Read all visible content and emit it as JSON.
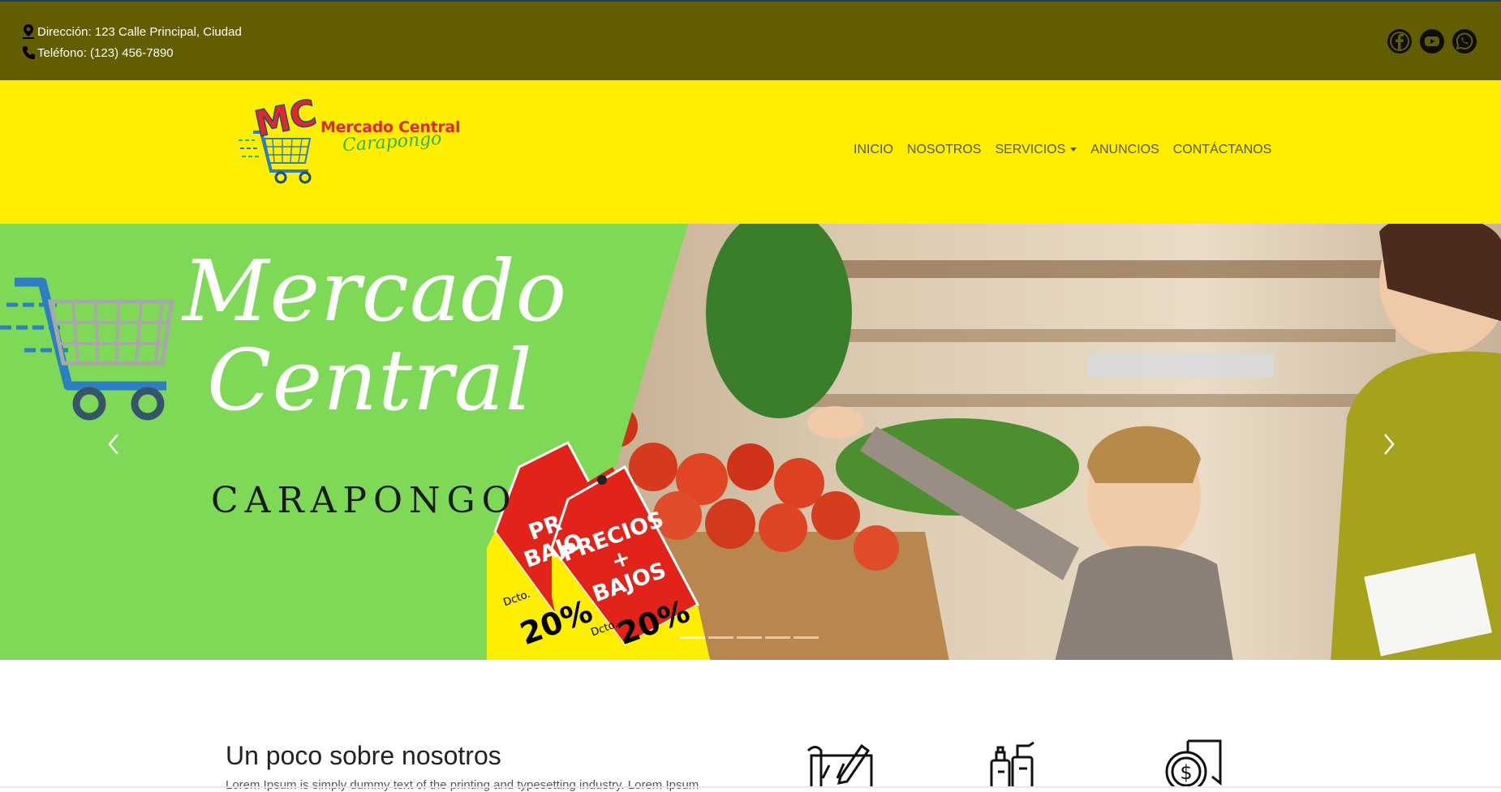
{
  "topbar": {
    "address": "Dirección: 123 Calle Principal, Ciudad",
    "phone": "Teléfono: (123) 456-7890",
    "social_icons": [
      "facebook-icon",
      "youtube-icon",
      "whatsapp-icon"
    ]
  },
  "brand": {
    "logo_letters": "MC",
    "logo_name": "Mercado Central",
    "logo_tagline": "Carapongo"
  },
  "nav": {
    "items": [
      "INICIO",
      "NOSOTROS",
      "SERVICIOS",
      "ANUNCIOS",
      "CONTÁCTANOS"
    ]
  },
  "hero": {
    "title_line1": "Mercado",
    "title_line2": "Central",
    "subtitle": "CARAPONGO",
    "tag_back_text": "PR\nBAJO",
    "tag_front_text": "PRECIOS\n+\nBAJOS",
    "tag_discount_label": "Dcto.",
    "tag_discount_value": "20%",
    "active_slide_index": 0,
    "slide_count": 5
  },
  "about": {
    "title": "Un poco sobre nosotros",
    "text": "Lorem Ipsum is simply dummy text of the printing and typesetting industry. Lorem Ipsum"
  },
  "features": {
    "icons": [
      "planning-icon",
      "cleaning-supplies-icon",
      "money-delivery-icon"
    ]
  },
  "colors": {
    "topbar_bg": "#615d00",
    "header_bg": "#ffee00",
    "hero_green": "#7ed957",
    "logo_red": "#e3262d"
  }
}
